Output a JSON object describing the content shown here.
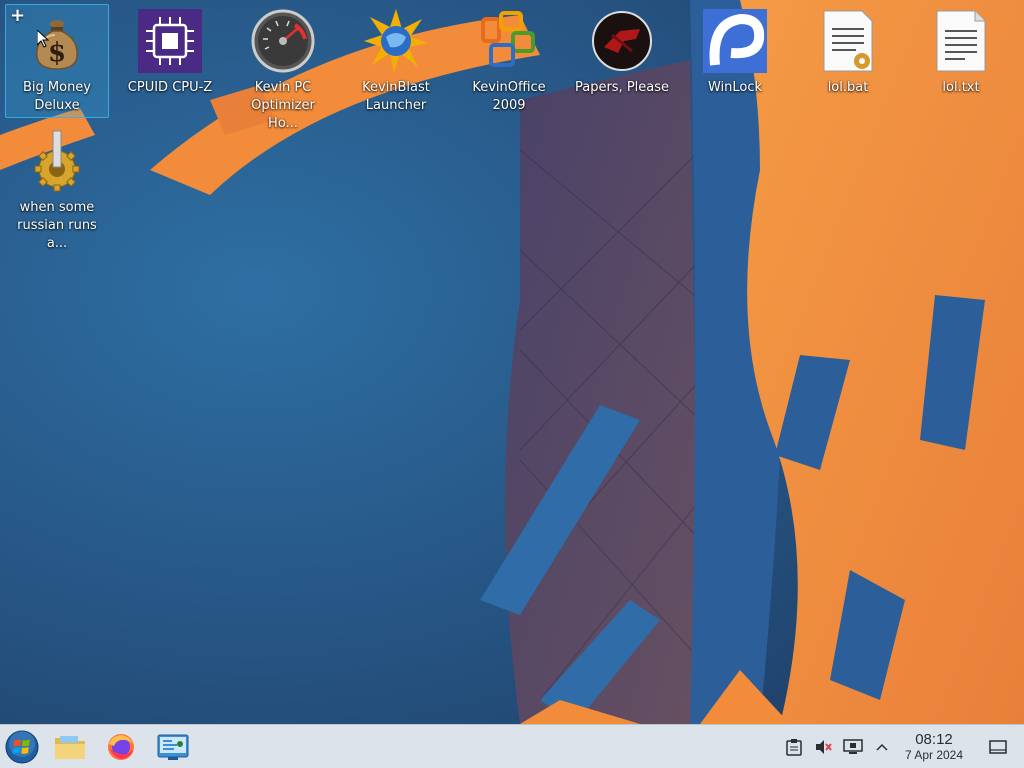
{
  "desktop": {
    "icons": [
      {
        "label": "Big Money\nDeluxe",
        "icon": "money-bag-icon",
        "selected": true
      },
      {
        "label": "CPUID CPU-Z",
        "icon": "cpu-chip-icon"
      },
      {
        "label": "Kevin PC\nOptimizer Ho...",
        "icon": "speedometer-icon"
      },
      {
        "label": "KevinBlast\nLauncher",
        "icon": "blast-launcher-icon"
      },
      {
        "label": "KevinOffice\n2009",
        "icon": "office-logo-icon"
      },
      {
        "label": "Papers, Please",
        "icon": "papers-please-seal-icon"
      },
      {
        "label": "WinLock",
        "icon": "winlock-icon"
      },
      {
        "label": "lol.bat",
        "icon": "batch-file-icon"
      },
      {
        "label": "lol.txt",
        "icon": "text-file-icon"
      },
      {
        "label": "when some\nrussian runs a...",
        "icon": "gear-executable-icon"
      }
    ],
    "add_symbol": "+"
  },
  "taskbar": {
    "launchers": [
      {
        "name": "start-menu-button",
        "icon": "windows-orb-icon"
      },
      {
        "name": "file-manager-button",
        "icon": "folder-icon"
      },
      {
        "name": "firefox-button",
        "icon": "firefox-icon"
      },
      {
        "name": "system-settings-button",
        "icon": "control-panel-icon"
      }
    ],
    "tray": {
      "clipboard_icon": "clipboard-icon",
      "volume_icon": "volume-muted-icon",
      "display_icon": "display-icon",
      "expand_icon": "chevron-up-icon"
    },
    "clock": {
      "time": "08:12",
      "date": "7 Apr 2024"
    },
    "show_desktop_icon": "show-desktop-icon"
  },
  "colors": {
    "wallpaper_blue": "#2a5a8a",
    "wallpaper_orange": "#f28c3a",
    "taskbar_bg": "#dde3ea",
    "selection": "#3daee9"
  }
}
